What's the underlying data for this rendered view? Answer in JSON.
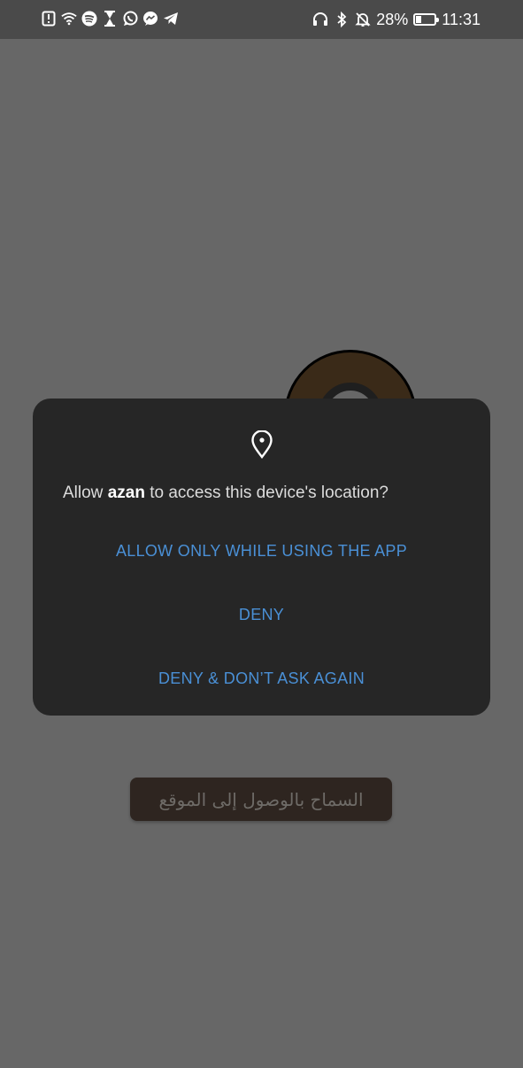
{
  "status_bar": {
    "battery_percent": "28%",
    "time": "11:31",
    "battery_level": 0.28,
    "left_icons": [
      "alert-icon",
      "wifi-icon",
      "spotify-icon",
      "hourglass-icon",
      "whatsapp-icon",
      "messenger-icon",
      "telegram-icon"
    ],
    "right_icons": [
      "headphones-icon",
      "bluetooth-icon",
      "bell-off-icon"
    ]
  },
  "dialog": {
    "question_prefix": "Allow ",
    "app_name": "azan",
    "question_suffix": " to access this device's location?",
    "allow_label": "ALLOW ONLY WHILE USING THE APP",
    "deny_label": "DENY",
    "deny_forever_label": "DENY & DON’T ASK AGAIN",
    "accent_color": "#4a90d6"
  },
  "app": {
    "location_button_label": "السماح بالوصول إلى الموقع"
  }
}
